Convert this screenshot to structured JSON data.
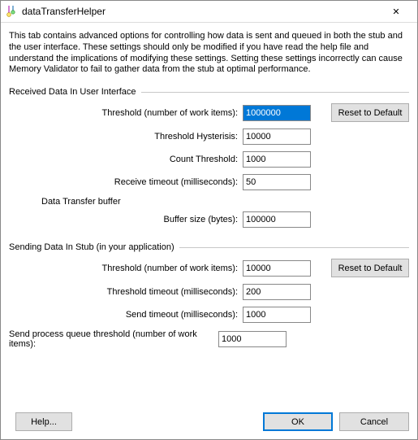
{
  "window": {
    "title": "dataTransferHelper",
    "close_label": "✕"
  },
  "desc": "This tab contains advanced options for controlling how data is sent and queued in both the stub and the user interface. These settings should only be modified if you have read the help file and understand the implications of modifying these settings. Setting these settings incorrectly can cause Memory Validator to fail to gather data from the stub at optimal performance.",
  "group_receive": {
    "title": "Received Data In User Interface",
    "threshold_label": "Threshold (number of work items):",
    "threshold_value": "1000000",
    "hyst_label": "Threshold Hysterisis:",
    "hyst_value": "10000",
    "count_label": "Count Threshold:",
    "count_value": "1000",
    "recv_timeout_label": "Receive timeout (milliseconds):",
    "recv_timeout_value": "50",
    "buffer_title": "Data Transfer buffer",
    "buffer_label": "Buffer size (bytes):",
    "buffer_value": "100000",
    "reset_label": "Reset to Default"
  },
  "group_send": {
    "title": "Sending Data In Stub (in your application)",
    "threshold_label": "Threshold (number of work items):",
    "threshold_value": "10000",
    "timeout_label": "Threshold timeout (milliseconds):",
    "timeout_value": "200",
    "send_timeout_label": "Send timeout (milliseconds):",
    "send_timeout_value": "1000",
    "proc_queue_label": "Send process queue threshold (number of work items):",
    "proc_queue_value": "1000",
    "reset_label": "Reset to Default"
  },
  "footer": {
    "help_label": "Help...",
    "ok_label": "OK",
    "cancel_label": "Cancel"
  }
}
